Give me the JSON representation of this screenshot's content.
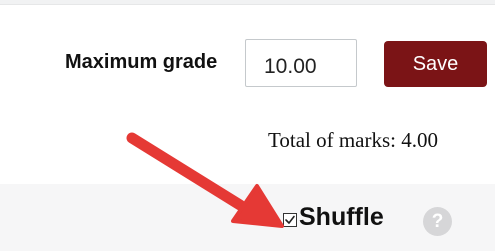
{
  "quiz_settings": {
    "max_grade_label": "Maximum grade",
    "max_grade_value": "10.00",
    "save_label": "Save",
    "total_marks_text": "Total of marks: 4.00",
    "shuffle_label": "Shuffle",
    "shuffle_checked": true,
    "help_glyph": "?"
  },
  "colors": {
    "save_button": "#7b1416",
    "annotation_arrow": "#e53935",
    "shuffle_band": "#f6f6f7"
  },
  "icons": {
    "help": "question-circle-icon",
    "checkbox": "checkbox-icon",
    "arrow": "annotation-arrow"
  }
}
